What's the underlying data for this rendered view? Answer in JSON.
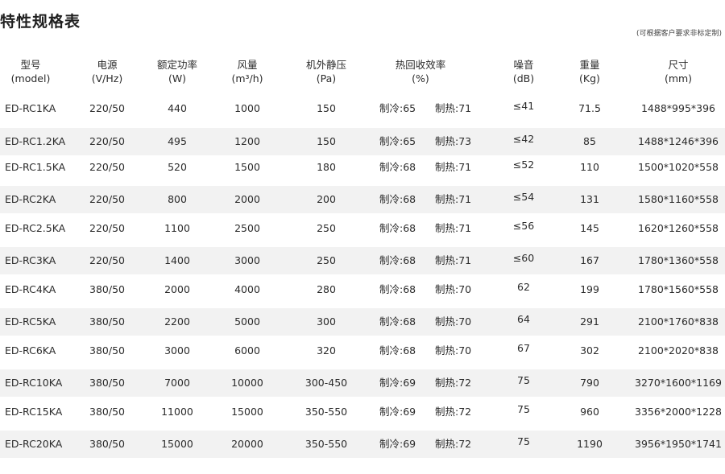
{
  "title": "特性规格表",
  "note": "(可根据客户要求非标定制)",
  "headers": [
    {
      "l1": "型号",
      "l2": "(model)"
    },
    {
      "l1": "电源",
      "l2": "(V/Hz)"
    },
    {
      "l1": "额定功率",
      "l2": "(W)"
    },
    {
      "l1": "风量",
      "l2": "(m³/h)"
    },
    {
      "l1": "机外静压",
      "l2": "(Pa)"
    },
    {
      "l1": "热回收效率",
      "l2": "(%)"
    },
    {
      "l1": "噪音",
      "l2": "(dB)"
    },
    {
      "l1": "重量",
      "l2": "(Kg)"
    },
    {
      "l1": "尺寸",
      "l2": "(mm)"
    }
  ],
  "rows": [
    {
      "model": "ED-RC1KA",
      "power": "220/50",
      "rated": "440",
      "air": "1000",
      "pressure": "150",
      "cool": "制冷:65",
      "heat": "制热:71",
      "noise": "≤41",
      "weight": "71.5",
      "size": "1488*995*396"
    },
    {
      "model": "ED-RC1.2KA",
      "power": "220/50",
      "rated": "495",
      "air": "1200",
      "pressure": "150",
      "cool": "制冷:65",
      "heat": "制热:73",
      "noise": "≤42",
      "weight": "85",
      "size": "1488*1246*396"
    },
    {
      "model": "ED-RC1.5KA",
      "power": "220/50",
      "rated": "520",
      "air": "1500",
      "pressure": "180",
      "cool": "制冷:68",
      "heat": "制热:71",
      "noise": "≤52",
      "weight": "110",
      "size": "1500*1020*558"
    },
    {
      "model": "ED-RC2KA",
      "power": "220/50",
      "rated": "800",
      "air": "2000",
      "pressure": "200",
      "cool": "制冷:68",
      "heat": "制热:71",
      "noise": "≤54",
      "weight": "131",
      "size": "1580*1160*558"
    },
    {
      "model": "ED-RC2.5KA",
      "power": "220/50",
      "rated": "1100",
      "air": "2500",
      "pressure": "250",
      "cool": "制冷:68",
      "heat": "制热:71",
      "noise": "≤56",
      "weight": "145",
      "size": "1620*1260*558"
    },
    {
      "model": "ED-RC3KA",
      "power": "220/50",
      "rated": "1400",
      "air": "3000",
      "pressure": "250",
      "cool": "制冷:68",
      "heat": "制热:71",
      "noise": "≤60",
      "weight": "167",
      "size": "1780*1360*558"
    },
    {
      "model": "ED-RC4KA",
      "power": "380/50",
      "rated": "2000",
      "air": "4000",
      "pressure": "280",
      "cool": "制冷:68",
      "heat": "制热:70",
      "noise": "62",
      "weight": "199",
      "size": "1780*1560*558"
    },
    {
      "model": "ED-RC5KA",
      "power": "380/50",
      "rated": "2200",
      "air": "5000",
      "pressure": "300",
      "cool": "制冷:68",
      "heat": "制热:70",
      "noise": "64",
      "weight": "291",
      "size": "2100*1760*838"
    },
    {
      "model": "ED-RC6KA",
      "power": "380/50",
      "rated": "3000",
      "air": "6000",
      "pressure": "320",
      "cool": "制冷:68",
      "heat": "制热:70",
      "noise": "67",
      "weight": "302",
      "size": "2100*2020*838"
    },
    {
      "model": "ED-RC10KA",
      "power": "380/50",
      "rated": "7000",
      "air": "10000",
      "pressure": "300-450",
      "cool": "制冷:69",
      "heat": "制热:72",
      "noise": "75",
      "weight": "790",
      "size": "3270*1600*1169"
    },
    {
      "model": "ED-RC15KA",
      "power": "380/50",
      "rated": "11000",
      "air": "15000",
      "pressure": "350-550",
      "cool": "制冷:69",
      "heat": "制热:72",
      "noise": "75",
      "weight": "960",
      "size": "3356*2000*1228"
    },
    {
      "model": "ED-RC20KA",
      "power": "380/50",
      "rated": "15000",
      "air": "20000",
      "pressure": "350-550",
      "cool": "制冷:69",
      "heat": "制热:72",
      "noise": "75",
      "weight": "1190",
      "size": "3956*1950*1741"
    }
  ]
}
